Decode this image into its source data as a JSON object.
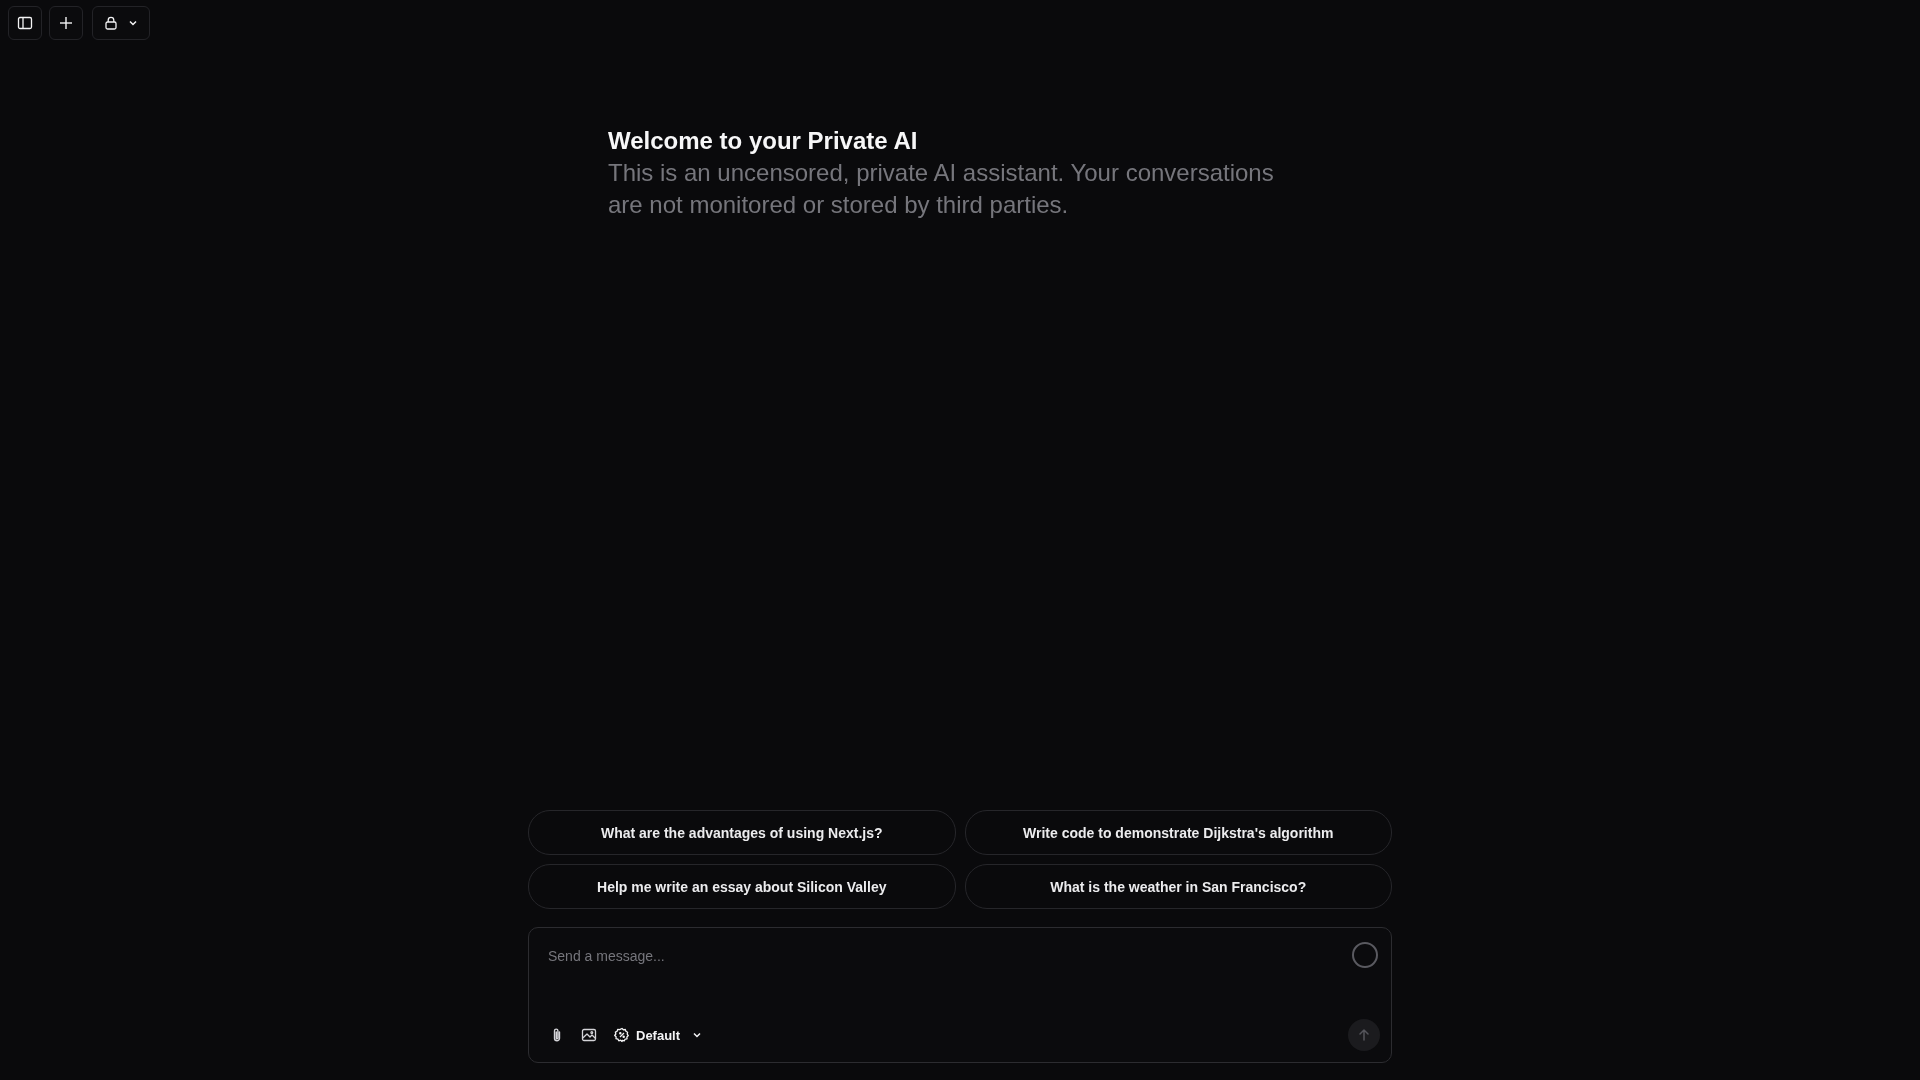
{
  "welcome": {
    "title": "Welcome to your Private AI",
    "subtitle": "This is an uncensored, private AI assistant. Your conversations are not monitored or stored by third parties."
  },
  "suggestions": [
    "What are the advantages of using Next.js?",
    "Write code to demonstrate Dijkstra's algorithm",
    "Help me write an essay about Silicon Valley",
    "What is the weather in San Francisco?"
  ],
  "composer": {
    "placeholder": "Send a message...",
    "mode": "Default",
    "send_button": {
      "disabled": true
    }
  }
}
